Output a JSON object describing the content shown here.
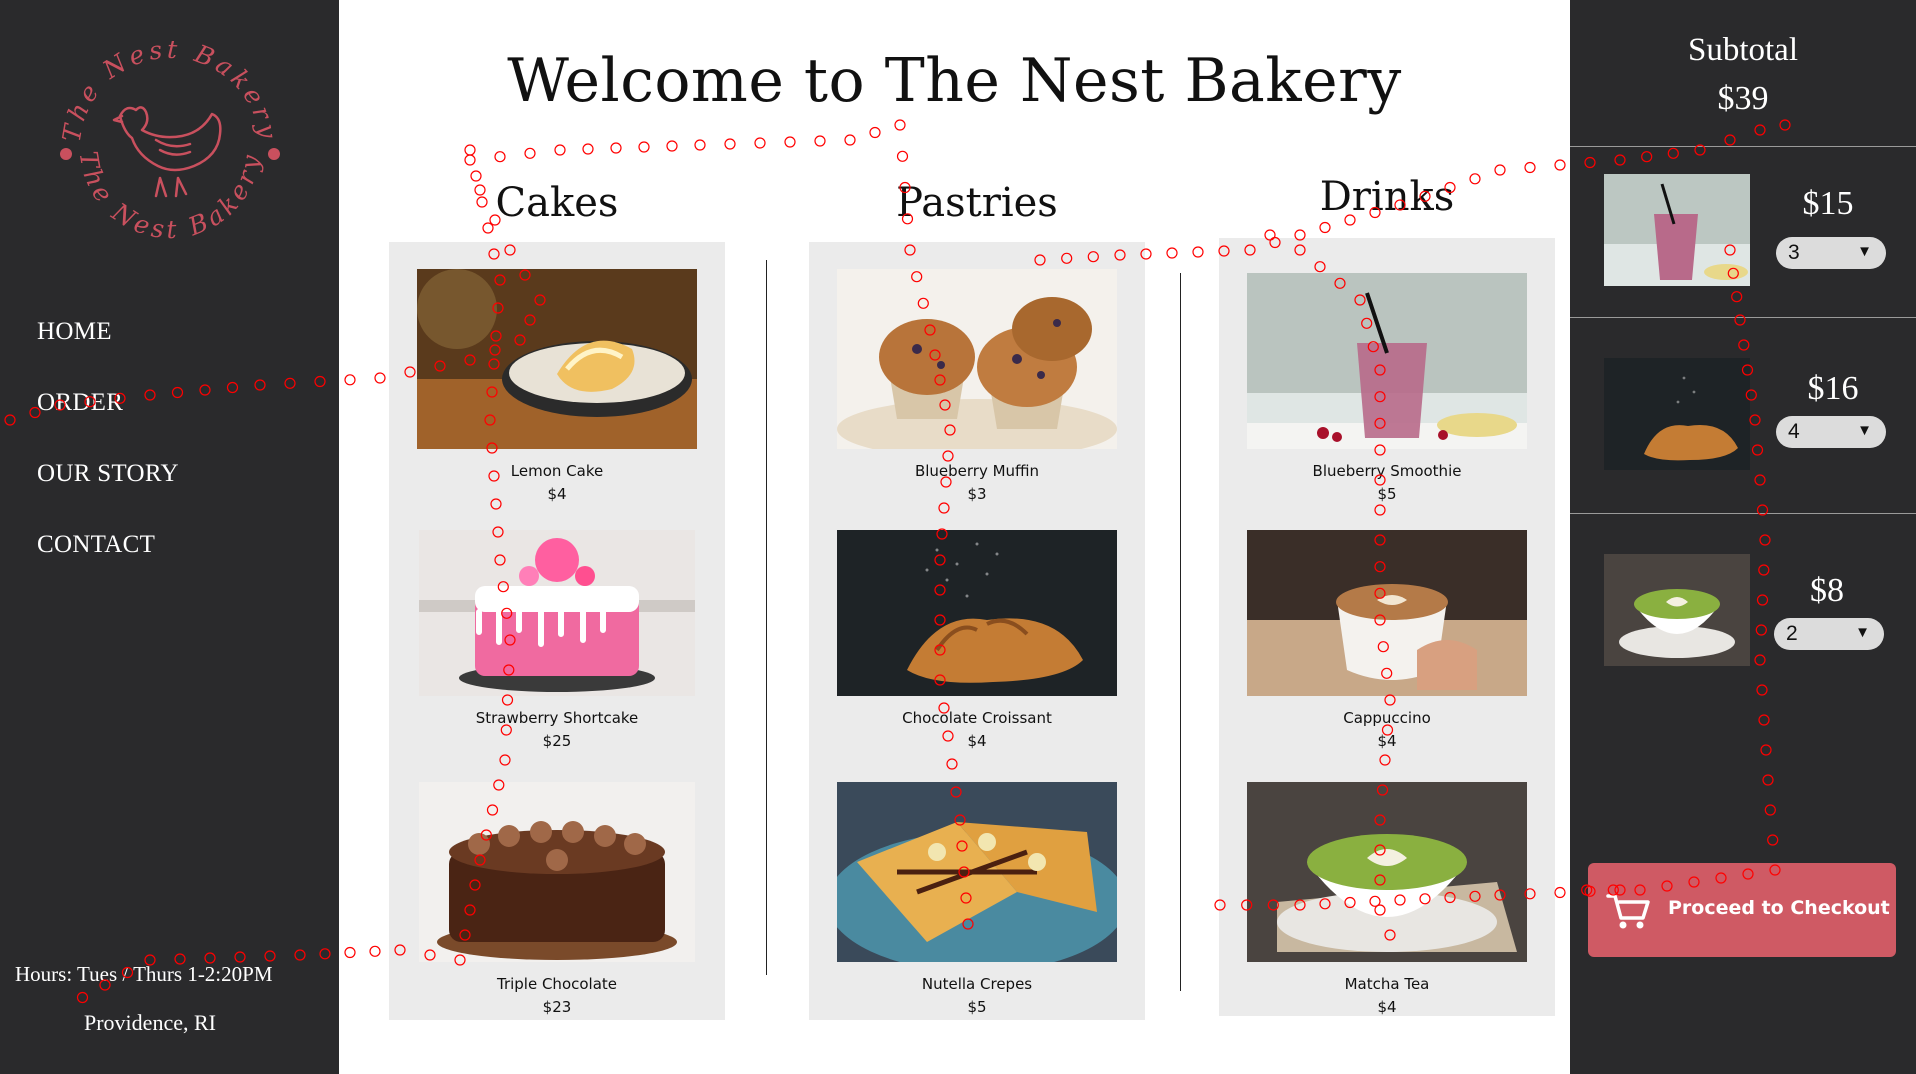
{
  "brand": {
    "logo_text_top": "The Nest Bakery",
    "logo_text_bottom": "The Nest Bakery",
    "accent": "#c9505e"
  },
  "nav": {
    "items": [
      {
        "label": "HOME"
      },
      {
        "label": "ORDER"
      },
      {
        "label": "OUR STORY"
      },
      {
        "label": "CONTACT"
      }
    ]
  },
  "footer": {
    "hours": "Hours: Tues / Thurs 1-2:20PM",
    "location": "Providence, RI"
  },
  "main": {
    "title": "Welcome to The Nest Bakery",
    "categories": [
      {
        "title": "Cakes",
        "items": [
          {
            "name": "Lemon Cake",
            "price": "$4",
            "icon": "lemon-cake-photo"
          },
          {
            "name": "Strawberry Shortcake",
            "price": "$25",
            "icon": "strawberry-shortcake-photo"
          },
          {
            "name": "Triple Chocolate",
            "price": "$23",
            "icon": "triple-chocolate-photo"
          }
        ]
      },
      {
        "title": "Pastries",
        "items": [
          {
            "name": "Blueberry Muffin",
            "price": "$3",
            "icon": "blueberry-muffin-photo"
          },
          {
            "name": "Chocolate Croissant",
            "price": "$4",
            "icon": "chocolate-croissant-photo"
          },
          {
            "name": "Nutella Crepes",
            "price": "$5",
            "icon": "nutella-crepes-photo"
          }
        ]
      },
      {
        "title": "Drinks",
        "items": [
          {
            "name": "Blueberry Smoothie",
            "price": "$5",
            "icon": "blueberry-smoothie-photo"
          },
          {
            "name": "Cappuccino",
            "price": "$4",
            "icon": "cappuccino-photo"
          },
          {
            "name": "Matcha Tea",
            "price": "$4",
            "icon": "matcha-tea-photo"
          }
        ]
      }
    ]
  },
  "cart": {
    "subtotal_label": "Subtotal",
    "subtotal_value": "$39",
    "items": [
      {
        "price": "$15",
        "qty": "3",
        "icon": "blueberry-smoothie-photo"
      },
      {
        "price": "$16",
        "qty": "4",
        "icon": "chocolate-croissant-photo"
      },
      {
        "price": "$8",
        "qty": "2",
        "icon": "matcha-tea-photo"
      }
    ],
    "checkout_label": "Proceed to Checkout",
    "checkout_color": "#cf5a64"
  },
  "gaze_overlay": {
    "color": "#ff0000"
  }
}
